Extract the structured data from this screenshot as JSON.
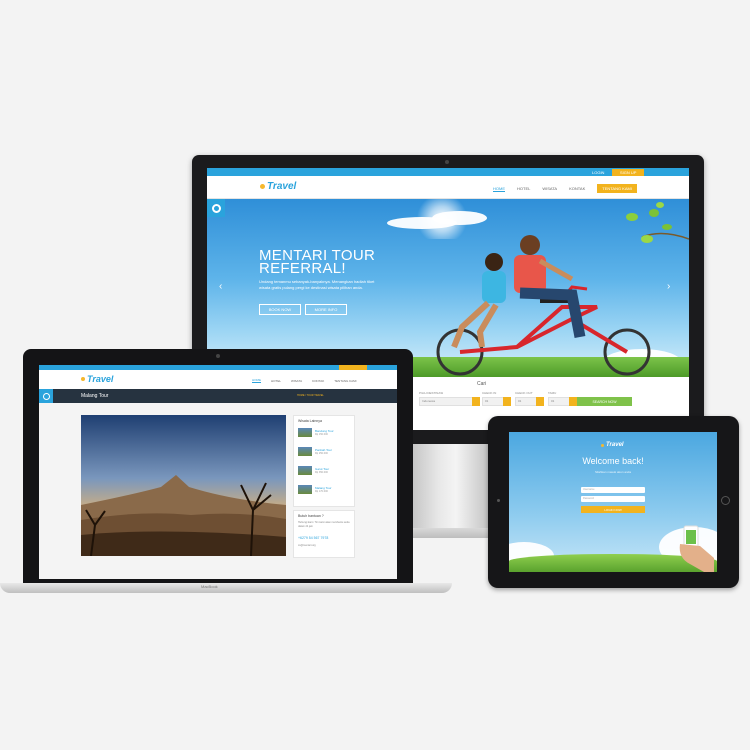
{
  "monitor": {
    "top_strip": {
      "login": "LOGIN",
      "sign_up": "SIGN UP"
    },
    "logo": "Travel",
    "nav": [
      "HOME",
      "HOTEL",
      "WISATA",
      "KONTAK",
      "TENTANG KAMI"
    ],
    "hero": {
      "title": "MENTARI TOUR REFERRAL!",
      "text": "Undang temanmu sebanyak-banyaknya. Menangkan hadiah tiket wisata gratis pulang pergi ke destinasi wisata pilihan anda.",
      "btn_book": "BOOK NOW",
      "btn_more": "MORE INFO",
      "arrow_left": "‹",
      "arrow_right": "›"
    },
    "search": {
      "heading": "Cari",
      "fields": [
        {
          "label": "PILIH DESTINASI",
          "value": "Indonesia"
        },
        {
          "label": "CHECK IN",
          "value": "01"
        },
        {
          "label": "CHECK OUT",
          "value": "01"
        },
        {
          "label": "TAMU",
          "value": "01"
        }
      ],
      "button": "SEARCH NOW"
    }
  },
  "laptop": {
    "logo": "Travel",
    "nav": [
      "HOME",
      "HOTEL",
      "WISATA",
      "KONTAK",
      "TENTANG KAMI"
    ],
    "page_title": "Malang Tour",
    "breadcrumb": "HOME / TOUR TRAVEL",
    "sidebar": {
      "heading": "Wisata Lainnya",
      "items": [
        {
          "name": "Bandung Tour",
          "price": "Rp 150.000"
        },
        {
          "name": "Panbah Tour",
          "price": "Rp 250.000"
        },
        {
          "name": "Garut Tour",
          "price": "Rp 350.000"
        },
        {
          "name": "Malang Tour",
          "price": "Rp 170.000"
        }
      ],
      "contact_heading": "Butuh bantuan ?",
      "contact_text": "Hubungi kami. Tim kami akan membantu anda dalam 24 jam",
      "phone": "+6279 54 567 7978",
      "email": "cs@mentari.org"
    },
    "brand": "MacBook"
  },
  "tablet": {
    "logo": "Travel",
    "welcome": "Welcome back!",
    "subtitle": "Silahkan masuk akun anda",
    "username_placeholder": "Username",
    "password_placeholder": "Password",
    "button": "LOGIN NOW"
  },
  "colors": {
    "brand_blue": "#2aa3dc",
    "accent_orange": "#f2b31e",
    "action_green": "#7fc24a"
  }
}
